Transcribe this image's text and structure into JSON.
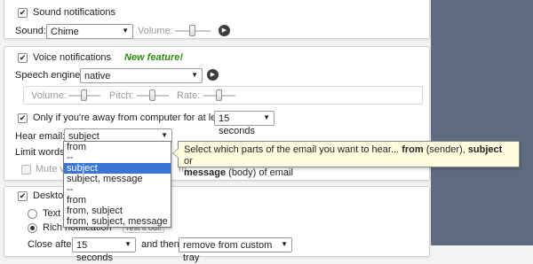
{
  "sound": {
    "checkbox_label": "Sound notifications",
    "sound_label": "Sound:",
    "sound_value": "Chime",
    "volume_label": "Volume:",
    "volume_level_percent": 45
  },
  "voice": {
    "checkbox_label": "Voice notifications",
    "new_feature": "New feature!",
    "engine_label": "Speech engine:",
    "engine_value": "native",
    "volume_label": "Volume:",
    "volume_level_percent": 50,
    "pitch_label": "Pitch:",
    "pitch_level_percent": 50,
    "rate_label": "Rate:",
    "rate_level_percent": 50,
    "away_label": "Only if you're away from computer for at least",
    "away_value": "15 seconds",
    "hear_email_label": "Hear email:",
    "hear_email_value": "subject",
    "limit_words_label": "Limit words",
    "mute_label": "Mute vo",
    "mute_suffix": "m"
  },
  "hear_email_options": [
    {
      "label": "from",
      "selected": false
    },
    {
      "label": "--",
      "selected": false
    },
    {
      "label": "subject",
      "selected": true
    },
    {
      "label": "subject, message",
      "selected": false
    },
    {
      "label": "--",
      "selected": false
    },
    {
      "label": "from",
      "selected": false
    },
    {
      "label": "from, subject",
      "selected": false
    },
    {
      "label": "from, subject, message",
      "selected": false
    }
  ],
  "tooltip": {
    "part1": "Select which parts of the email you want to hear... ",
    "from_bold": "from",
    "part2": " (sender), ",
    "subject_bold": "subject",
    "part3": " or",
    "message_bold": "message",
    "part4": " (body) of email"
  },
  "desktop": {
    "checkbox_label": "Desktop",
    "text_option": "Text n",
    "rich_option": "Rich notification",
    "test_it": "Test it out!",
    "close_after_label": "Close after",
    "close_after_value": "15 seconds",
    "and_then_label": "and then",
    "and_then_value": "remove from custom tray"
  }
}
